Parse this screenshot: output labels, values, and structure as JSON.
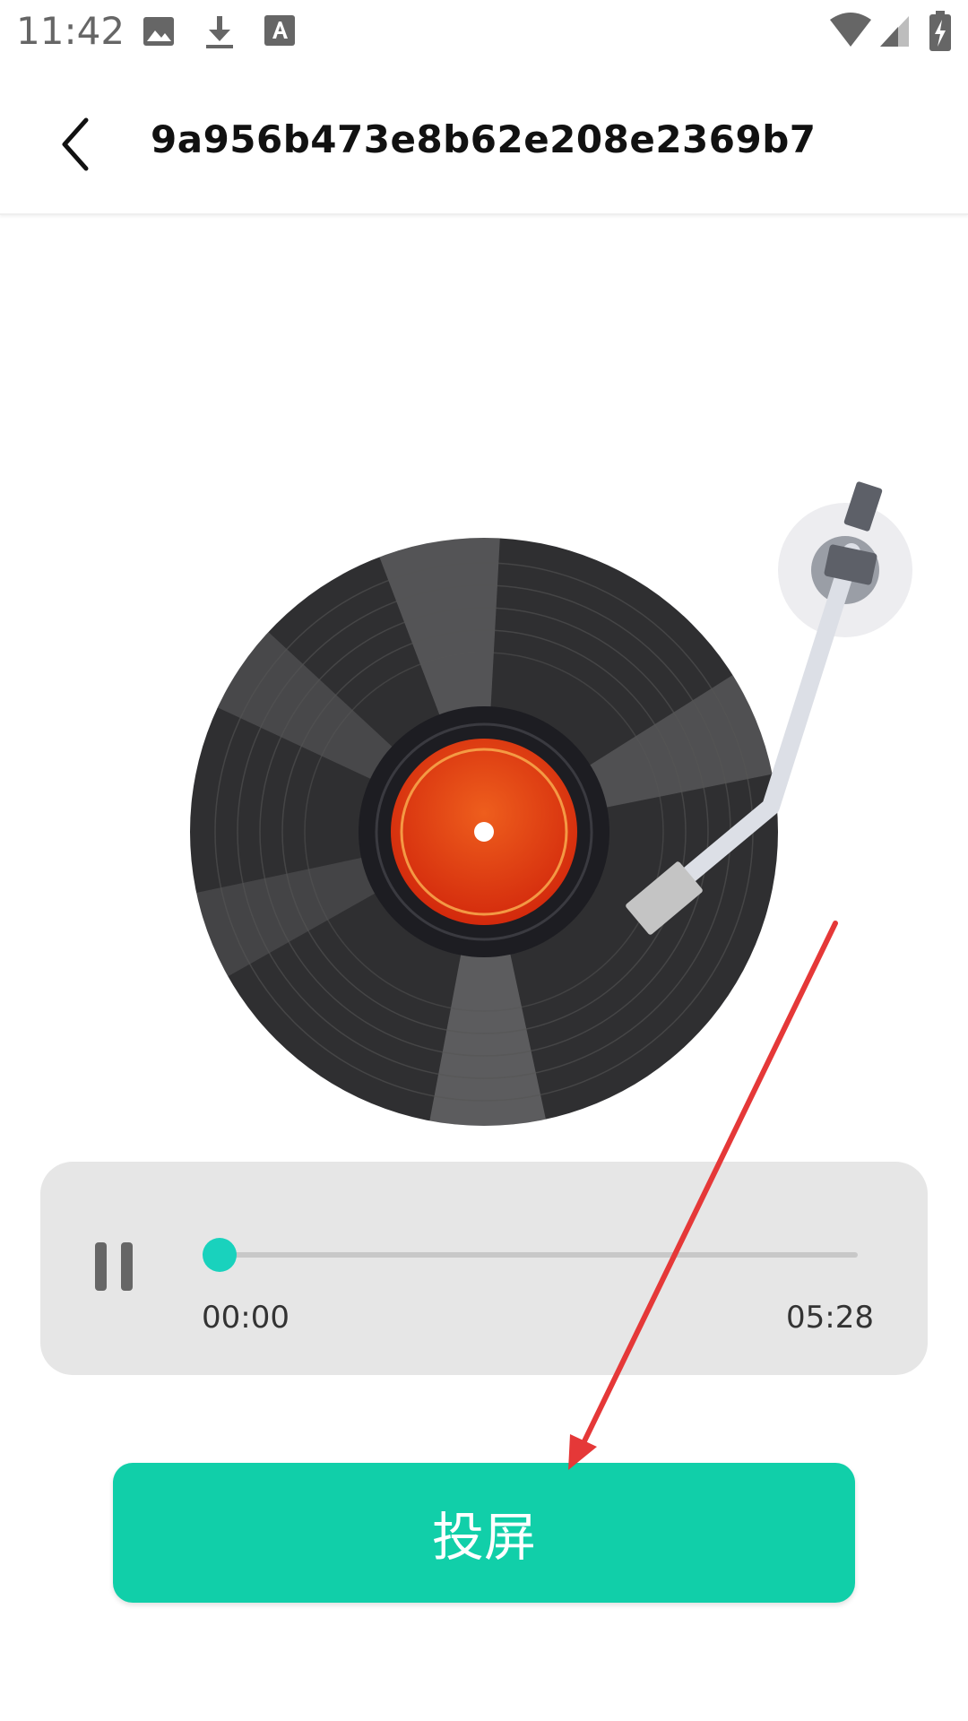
{
  "status_bar": {
    "time": "11:42",
    "left_icons": [
      "image-icon",
      "download-icon",
      "text-a-icon"
    ],
    "right_icons": [
      "wifi-icon",
      "signal-icon",
      "battery-charging-icon"
    ]
  },
  "app_bar": {
    "back_icon": "chevron-left-icon",
    "title": "9a956b473e8b62e208e2369b7b…"
  },
  "player": {
    "state_icon": "pause-icon",
    "current_time": "00:00",
    "total_time": "05:28",
    "progress": 0.0
  },
  "cast_button": {
    "label": "投屏"
  },
  "colors": {
    "accent": "#11cfa9",
    "slider_thumb": "#19d2bd",
    "record_label": "#e34d1f",
    "annotation_arrow": "#e53838"
  }
}
